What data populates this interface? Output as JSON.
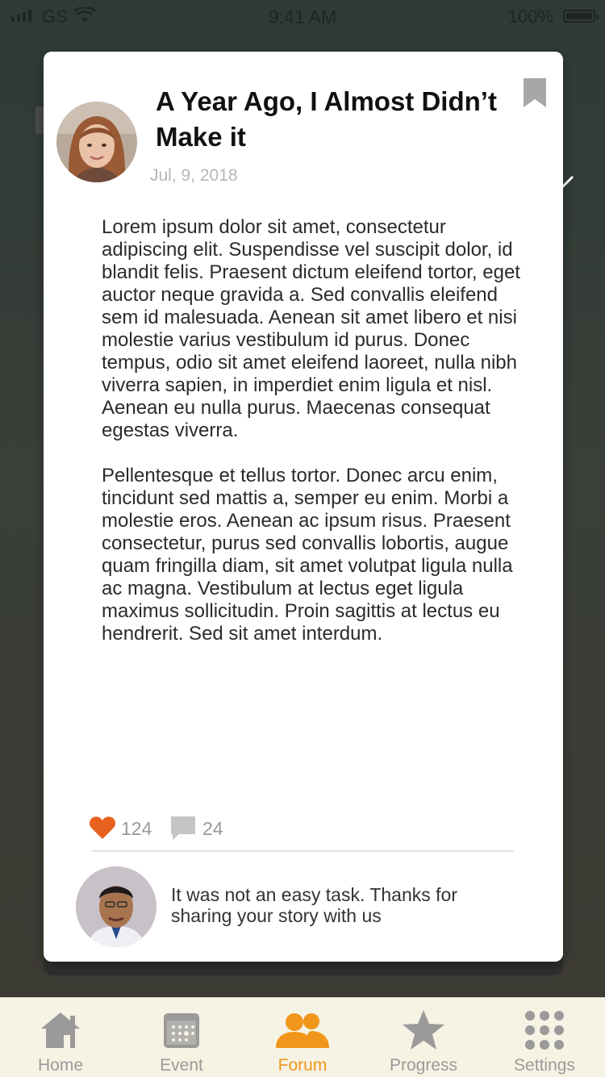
{
  "status_bar": {
    "carrier": "GS",
    "time": "9:41 AM",
    "battery": "100%"
  },
  "post": {
    "title": "A Year Ago, I Almost Didn’t Make it",
    "date": "Jul, 9, 2018",
    "paragraphs": [
      "Lorem ipsum dolor sit amet, consectetur adipiscing elit. Suspendisse vel suscipit dolor, id blandit felis. Praesent dictum eleifend tortor, eget auctor neque gravida a. Sed convallis eleifend sem id malesuada. Aenean sit amet libero et nisi molestie varius vestibulum id purus. Donec tempus, odio sit amet eleifend laoreet, nulla nibh viverra sapien, in imperdiet enim ligula et nisl. Aenean eu nulla purus. Maecenas consequat egestas viverra.",
      "Pellentesque et tellus tortor. Donec arcu enim, tincidunt sed mattis a, semper eu enim. Morbi a molestie eros. Aenean ac ipsum risus. Praesent consectetur, purus sed convallis lobortis, augue quam fringilla diam, sit amet volutpat ligula nulla ac magna. Vestibulum at lectus eget ligula maximus sollicitudin. Proin sagittis at lectus eu hendrerit. Sed sit amet interdum."
    ],
    "likes": "124",
    "comments": "24"
  },
  "comment": {
    "text": "It was not an easy task. Thanks for sharing your story with us"
  },
  "tabs": [
    {
      "label": "Home",
      "icon": "home-icon",
      "active": false
    },
    {
      "label": "Event",
      "icon": "calendar-icon",
      "active": false
    },
    {
      "label": "Forum",
      "icon": "people-icon",
      "active": true
    },
    {
      "label": "Progress",
      "icon": "star-icon",
      "active": false
    },
    {
      "label": "Settings",
      "icon": "grid-dots-icon",
      "active": false
    }
  ],
  "colors": {
    "accent": "#f0961a",
    "heart": "#e8621f",
    "inactive": "#9a9a9a"
  }
}
